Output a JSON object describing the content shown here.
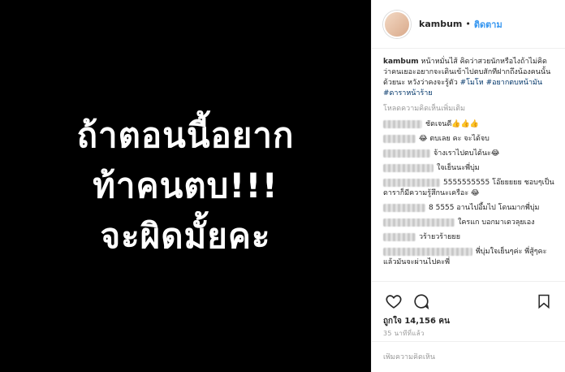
{
  "post": {
    "lines": [
      "ถ้าตอนนี้อยาก",
      "ท้าคนตบ!!!",
      "จะผิดมั้ยคะ"
    ]
  },
  "header": {
    "username": "kambum",
    "dot": "•",
    "follow_label": "ติดตาม"
  },
  "caption": {
    "username": "kambum",
    "text": " หน้าหมั่นไส้ คิดว่าสวยนักหรือไงถ้าไม่คิดว่าคนเยอะอยากจะเดินเข้าไปตบสักทีฝากถึงน้องคนนั้นด้วยนะ หวังว่าคงจะรู้ตัว ",
    "tags": [
      "#โมโห",
      "#อยากตบหน้ามัน",
      "#ดาราหน้าร้าย"
    ]
  },
  "load_more_label": "โหลดความคิดเห็นเพิ่มเติม",
  "comments": [
    {
      "text": "ชัดเจนดี👍👍👍"
    },
    {
      "text": "😂 ตบเลย คะ จะได้จบ"
    },
    {
      "text": "จ้างเราไปตบได้นะ😂"
    },
    {
      "text": "ใจเย็นนะพี่บุ่ม"
    },
    {
      "text": "5555555555 โอ๊ยยยยย ชอบๆเป็นดาราก็มีความรู้สึกนะเครือะ 😂"
    },
    {
      "text": "8 5555 อานไปอึ้มไป โดนมากพี่บุ่ม"
    },
    {
      "text": "ใครแก บอกมาเดวลุยเอง"
    },
    {
      "text": "วร้ายวร้ายยย"
    },
    {
      "text": "พี่บุ่มใจเย็นๆค่ะ พี่สู้ๆคะแล้วมันจะผ่านไปคะพี่"
    }
  ],
  "likes_text": "ถูกใจ 14,156 คน",
  "time_text": "35 นาทีที่แล้ว",
  "add_comment": {
    "placeholder": "เพิ่มความคิดเห็น"
  },
  "colors": {
    "link": "#3897f0",
    "hashtag": "#003569",
    "muted": "#999999"
  }
}
